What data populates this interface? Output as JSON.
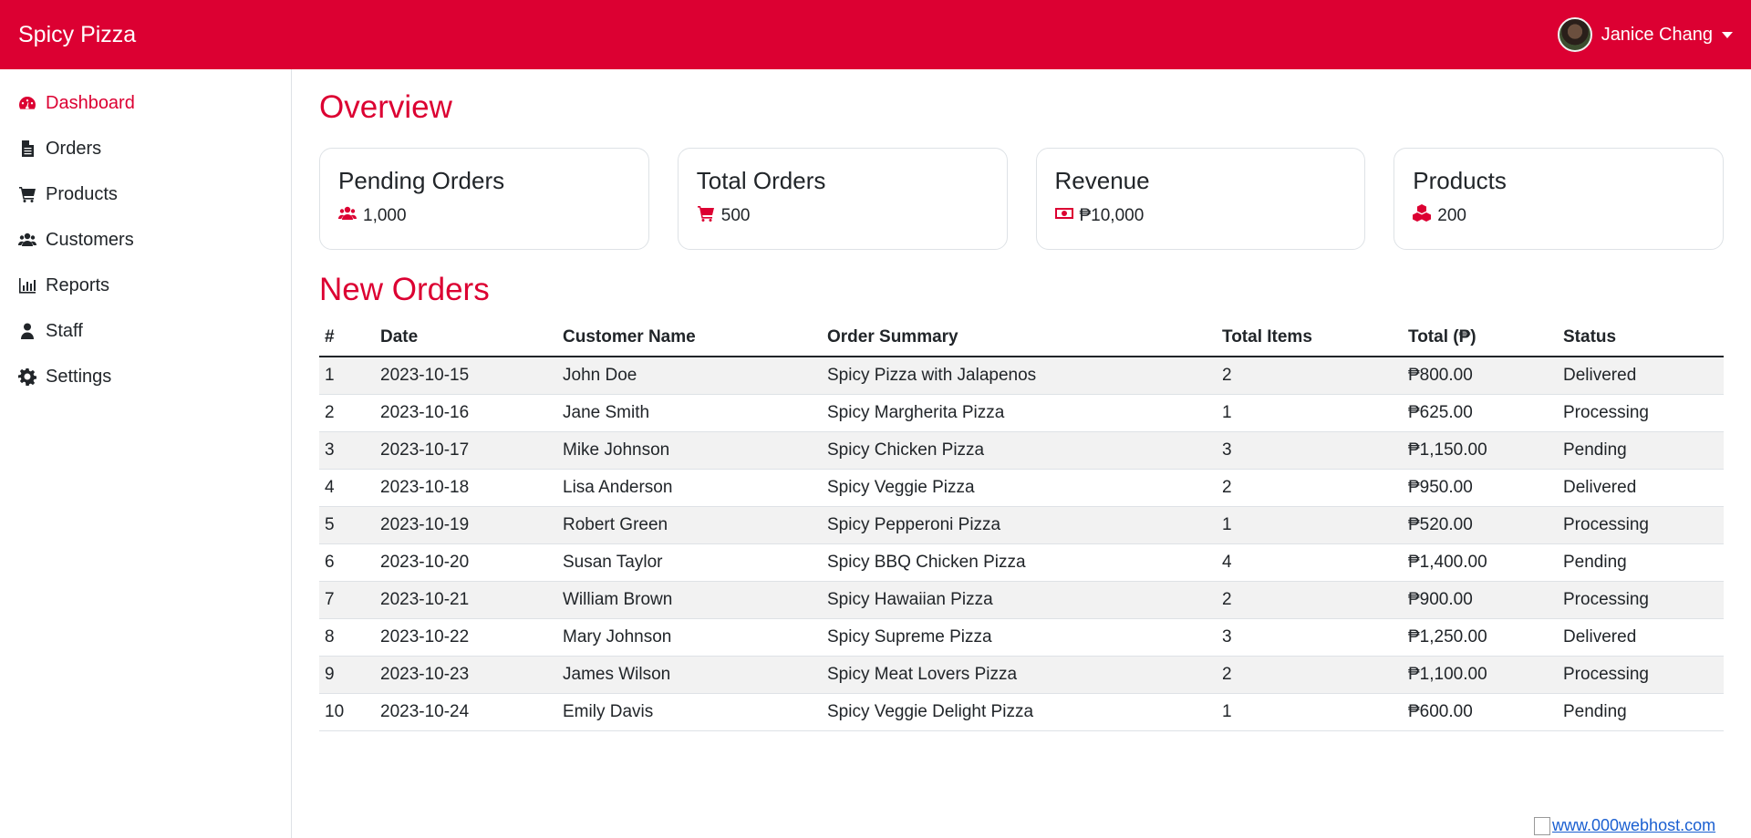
{
  "header": {
    "brand": "Spicy Pizza",
    "user_name": "Janice Chang",
    "accent_color": "#dc0032"
  },
  "sidebar": {
    "items": [
      {
        "label": "Dashboard",
        "icon": "dashboard-icon",
        "active": true
      },
      {
        "label": "Orders",
        "icon": "file-icon"
      },
      {
        "label": "Products",
        "icon": "cart-icon"
      },
      {
        "label": "Customers",
        "icon": "users-icon"
      },
      {
        "label": "Reports",
        "icon": "bar-chart-icon"
      },
      {
        "label": "Staff",
        "icon": "user-icon"
      },
      {
        "label": "Settings",
        "icon": "gear-icon"
      }
    ]
  },
  "overview": {
    "title": "Overview",
    "cards": [
      {
        "title": "Pending Orders",
        "value": "1,000",
        "icon": "users-icon"
      },
      {
        "title": "Total Orders",
        "value": "500",
        "icon": "cart-icon"
      },
      {
        "title": "Revenue",
        "value": "₱10,000",
        "icon": "money-icon"
      },
      {
        "title": "Products",
        "value": "200",
        "icon": "cubes-icon"
      }
    ]
  },
  "orders": {
    "title": "New Orders",
    "columns": [
      "#",
      "Date",
      "Customer Name",
      "Order Summary",
      "Total Items",
      "Total (₱)",
      "Status"
    ],
    "rows": [
      [
        "1",
        "2023-10-15",
        "John Doe",
        "Spicy Pizza with Jalapenos",
        "2",
        "₱800.00",
        "Delivered"
      ],
      [
        "2",
        "2023-10-16",
        "Jane Smith",
        "Spicy Margherita Pizza",
        "1",
        "₱625.00",
        "Processing"
      ],
      [
        "3",
        "2023-10-17",
        "Mike Johnson",
        "Spicy Chicken Pizza",
        "3",
        "₱1,150.00",
        "Pending"
      ],
      [
        "4",
        "2023-10-18",
        "Lisa Anderson",
        "Spicy Veggie Pizza",
        "2",
        "₱950.00",
        "Delivered"
      ],
      [
        "5",
        "2023-10-19",
        "Robert Green",
        "Spicy Pepperoni Pizza",
        "1",
        "₱520.00",
        "Processing"
      ],
      [
        "6",
        "2023-10-20",
        "Susan Taylor",
        "Spicy BBQ Chicken Pizza",
        "4",
        "₱1,400.00",
        "Pending"
      ],
      [
        "7",
        "2023-10-21",
        "William Brown",
        "Spicy Hawaiian Pizza",
        "2",
        "₱900.00",
        "Processing"
      ],
      [
        "8",
        "2023-10-22",
        "Mary Johnson",
        "Spicy Supreme Pizza",
        "3",
        "₱1,250.00",
        "Delivered"
      ],
      [
        "9",
        "2023-10-23",
        "James Wilson",
        "Spicy Meat Lovers Pizza",
        "2",
        "₱1,100.00",
        "Processing"
      ],
      [
        "10",
        "2023-10-24",
        "Emily Davis",
        "Spicy Veggie Delight Pizza",
        "1",
        "₱600.00",
        "Pending"
      ]
    ]
  },
  "footer": {
    "hosting_link": "www.000webhost.com"
  }
}
